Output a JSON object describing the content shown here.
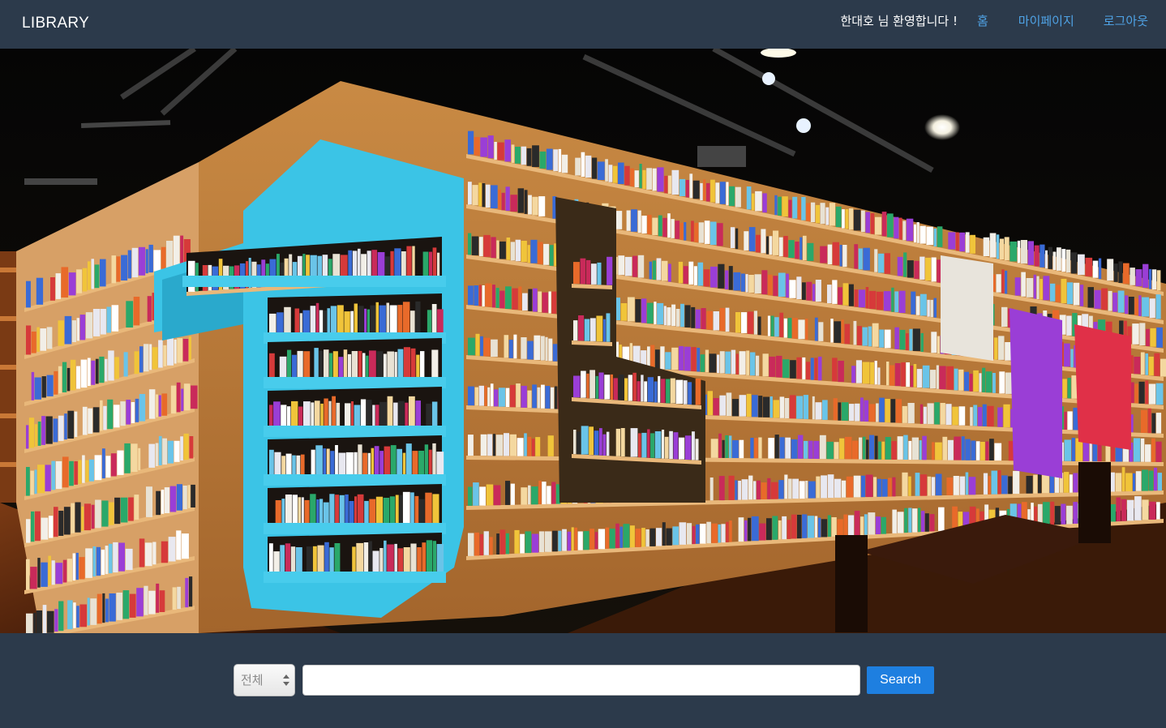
{
  "navbar": {
    "brand": "LIBRARY",
    "welcome": "한대호 님 환영합니다 !",
    "links": {
      "home": "홈",
      "mypage": "마이페이지",
      "logout": "로그아웃"
    },
    "link_color": "#4fa3e6",
    "background": "#2c3a4b"
  },
  "hero": {
    "image": "library-bookshelves-photo"
  },
  "search": {
    "category_selected": "전체",
    "query_value": "",
    "button_label": "Search",
    "button_color": "#1e7fe0"
  }
}
